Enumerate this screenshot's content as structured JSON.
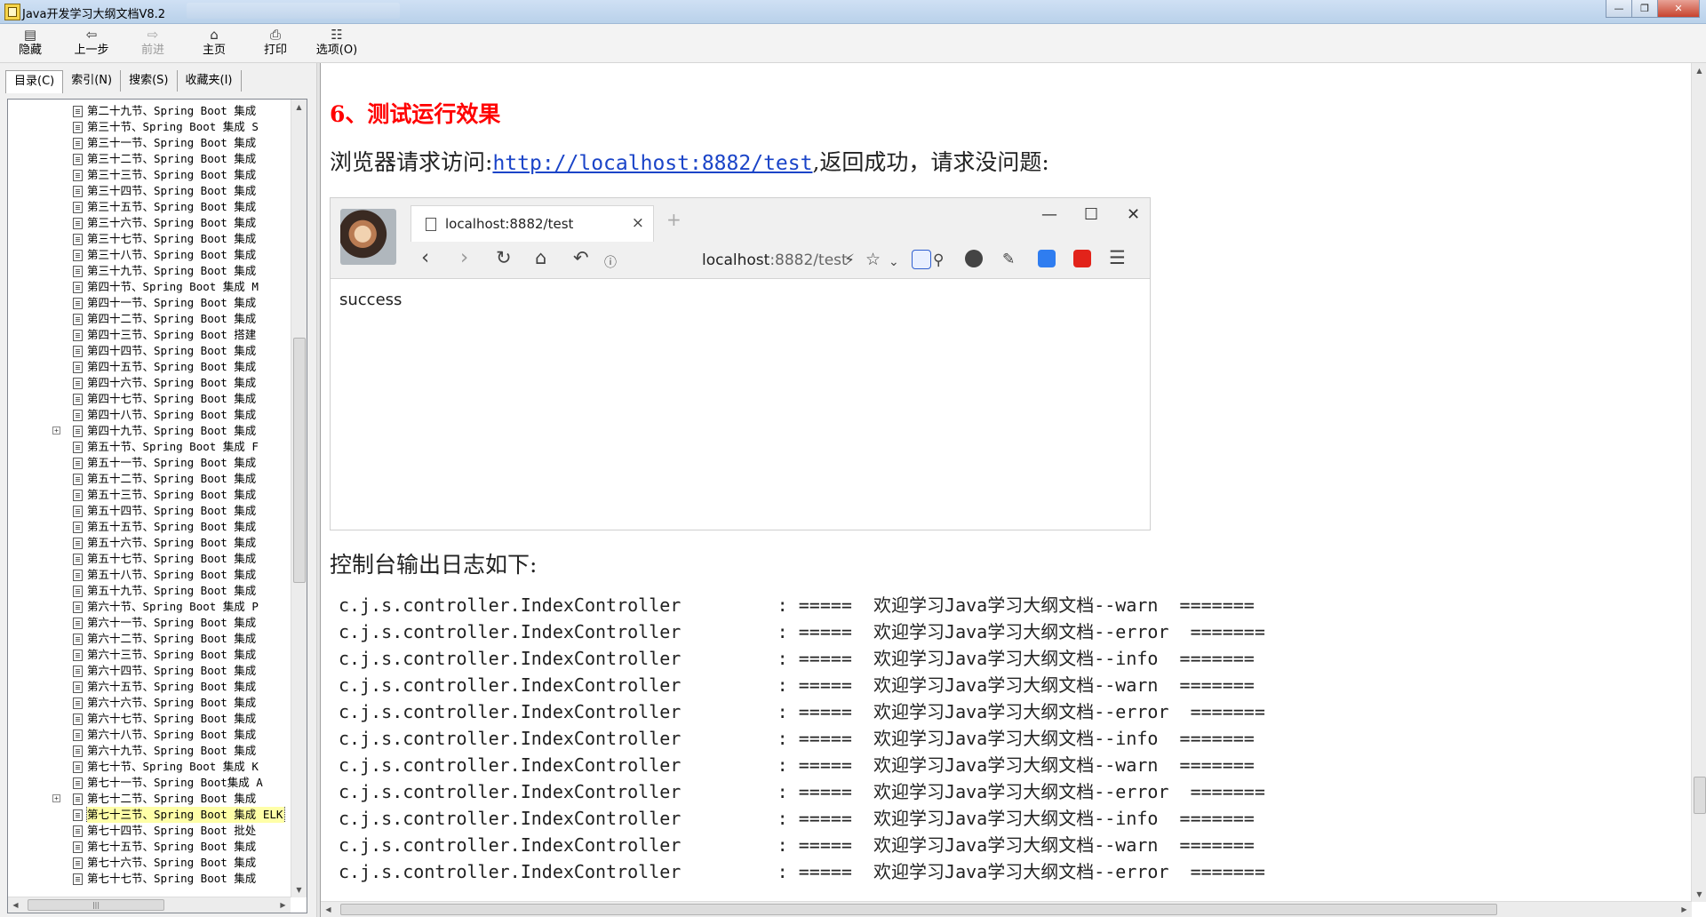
{
  "window": {
    "title": "Java开发学习大纲文档V8.2",
    "controls": {
      "minimize": "—",
      "restore": "❐",
      "close": "✕"
    }
  },
  "toolbar": {
    "hide": "隐藏",
    "back": "上一步",
    "forward": "前进",
    "home": "主页",
    "print": "打印",
    "options": "选项(O)"
  },
  "left_tabs": [
    "目录(C)",
    "索引(N)",
    "搜索(S)",
    "收藏夹(I)"
  ],
  "tree_items": [
    "第二十九节、Spring Boot 集成",
    "第三十节、Spring Boot 集成 S",
    "第三十一节、Spring Boot 集成",
    "第三十二节、Spring Boot 集成",
    "第三十三节、Spring Boot 集成",
    "第三十四节、Spring Boot 集成",
    "第三十五节、Spring Boot 集成",
    "第三十六节、Spring Boot 集成",
    "第三十七节、Spring Boot 集成",
    "第三十八节、Spring Boot 集成",
    "第三十九节、Spring Boot 集成",
    "第四十节、Spring Boot 集成 M",
    "第四十一节、Spring Boot 集成",
    "第四十二节、Spring Boot 集成",
    "第四十三节、Spring Boot 搭建",
    "第四十四节、Spring Boot 集成",
    "第四十五节、Spring Boot 集成",
    "第四十六节、Spring Boot 集成",
    "第四十七节、Spring Boot 集成",
    "第四十八节、Spring Boot 集成",
    "第四十九节、Spring Boot 集成",
    "第五十节、Spring Boot 集成 F",
    "第五十一节、Spring Boot 集成",
    "第五十二节、Spring Boot 集成",
    "第五十三节、Spring Boot 集成",
    "第五十四节、Spring Boot 集成",
    "第五十五节、Spring Boot 集成",
    "第五十六节、Spring Boot 集成",
    "第五十七节、Spring Boot 集成",
    "第五十八节、Spring Boot 集成",
    "第五十九节、Spring Boot 集成",
    "第六十节、Spring Boot 集成 P",
    "第六十一节、Spring Boot 集成",
    "第六十二节、Spring Boot 集成",
    "第六十三节、Spring Boot 集成",
    "第六十四节、Spring Boot 集成",
    "第六十五节、Spring Boot 集成",
    "第六十六节、Spring Boot 集成",
    "第六十七节、Spring Boot 集成",
    "第六十八节、Spring Boot 集成",
    "第六十九节、Spring Boot 集成",
    "第七十节、Spring Boot 集成 K",
    "第七十一节、Spring Boot集成 A",
    "第七十二节、Spring Boot 集成",
    "第七十三节、Spring Boot 集成 ELK",
    "第七十四节、Spring Boot 批处",
    "第七十五节、Spring Boot 集成",
    "第七十六节、Spring Boot 集成",
    "第七十七节、Spring Boot 集成"
  ],
  "tree_expanders": {
    "20": "+",
    "43": "+"
  },
  "tree_selected_index": 44,
  "content": {
    "heading": "6、测试运行效果",
    "para_prefix": "浏览器请求访问:",
    "link": "http://localhost:8882/test",
    "para_suffix": ",返回成功，请求没问题:",
    "para2": "控制台输出日志如下:"
  },
  "browser": {
    "tab_title": "localhost:8882/test",
    "address_host": "localhost",
    "address_path": ":8882/test",
    "page_text": "success",
    "icons": [
      "back-icon",
      "forward-icon",
      "reload-icon",
      "home-icon",
      "undo-icon",
      "info-icon",
      "bolt-icon",
      "star-icon",
      "chevron-down-icon",
      "baidu-icon",
      "search-icon",
      "globe-icon",
      "extension-icon",
      "bookmark-ext-icon",
      "fe-icon",
      "menu-icon"
    ]
  },
  "log_lines": [
    "c.j.s.controller.IndexController         : =====  欢迎学习Java学习大纲文档--warn  =======",
    "c.j.s.controller.IndexController         : =====  欢迎学习Java学习大纲文档--error  =======",
    "c.j.s.controller.IndexController         : =====  欢迎学习Java学习大纲文档--info  =======",
    "c.j.s.controller.IndexController         : =====  欢迎学习Java学习大纲文档--warn  =======",
    "c.j.s.controller.IndexController         : =====  欢迎学习Java学习大纲文档--error  =======",
    "c.j.s.controller.IndexController         : =====  欢迎学习Java学习大纲文档--info  =======",
    "c.j.s.controller.IndexController         : =====  欢迎学习Java学习大纲文档--warn  =======",
    "c.j.s.controller.IndexController         : =====  欢迎学习Java学习大纲文档--error  =======",
    "c.j.s.controller.IndexController         : =====  欢迎学习Java学习大纲文档--info  =======",
    "c.j.s.controller.IndexController         : =====  欢迎学习Java学习大纲文档--warn  =======",
    "c.j.s.controller.IndexController         : =====  欢迎学习Java学习大纲文档--error  ======="
  ],
  "colors": {
    "heading": "#ff0000",
    "link": "#1a44c8",
    "selected_item": "#ffffa8"
  }
}
